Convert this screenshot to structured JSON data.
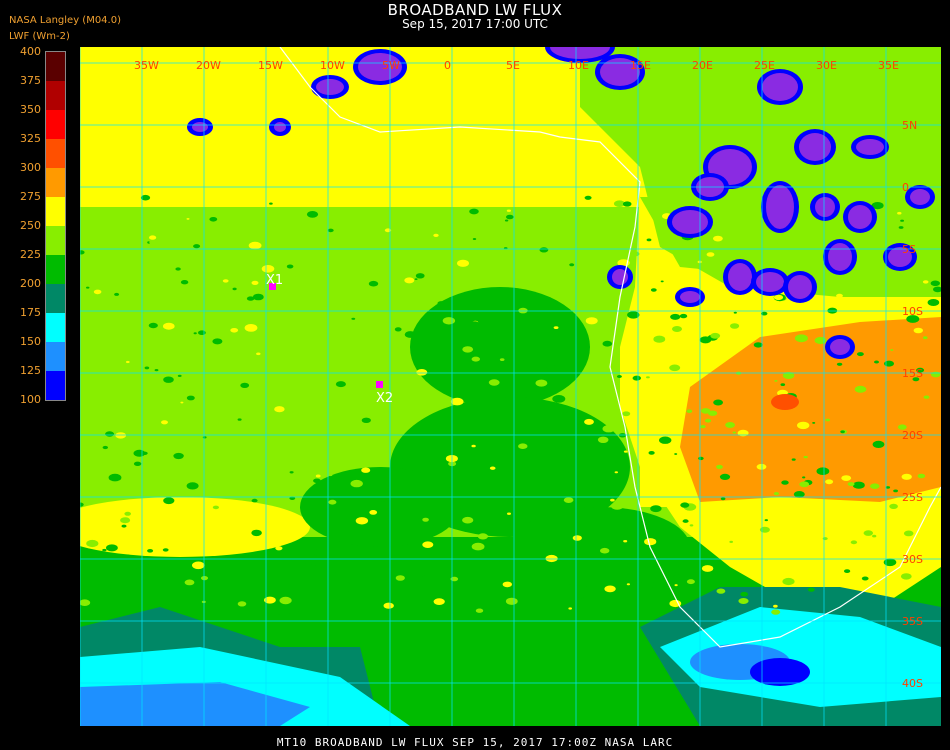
{
  "title": "BROADBAND LW FLUX",
  "subtitle": "Sep 15, 2017 17:00 UTC",
  "organization": "NASA Langley (M04.0)",
  "units": "LWF (Wm-2)",
  "footer": "MT10  BROADBAND LW FLUX   SEP 15, 2017 17:00Z   NASA LARC",
  "legend": {
    "ticks": [
      "400",
      "375",
      "350",
      "325",
      "300",
      "275",
      "250",
      "225",
      "200",
      "175",
      "150",
      "125",
      "100"
    ],
    "colors": [
      "#5a0000",
      "#b00000",
      "#ff0000",
      "#ff5000",
      "#ff9a00",
      "#ffff00",
      "#88ee00",
      "#00bb00",
      "#008866",
      "#00ffff",
      "#1e90ff",
      "#0000ff",
      "#8a2be2"
    ]
  },
  "grid": {
    "lon_labels": [
      "35W",
      "20W",
      "15W",
      "10W",
      "5W",
      "0",
      "5E",
      "10E",
      "15E",
      "20E",
      "25E",
      "30E",
      "35E"
    ],
    "lat_labels": [
      "5N",
      "0",
      "5S",
      "10S",
      "15S",
      "20S",
      "25S",
      "30S",
      "35S",
      "40S"
    ],
    "color": "#00e5ff"
  },
  "markers": [
    {
      "label": "X1",
      "color": "#ff00ff"
    },
    {
      "label": "X2",
      "color": "#ff00ff"
    }
  ]
}
